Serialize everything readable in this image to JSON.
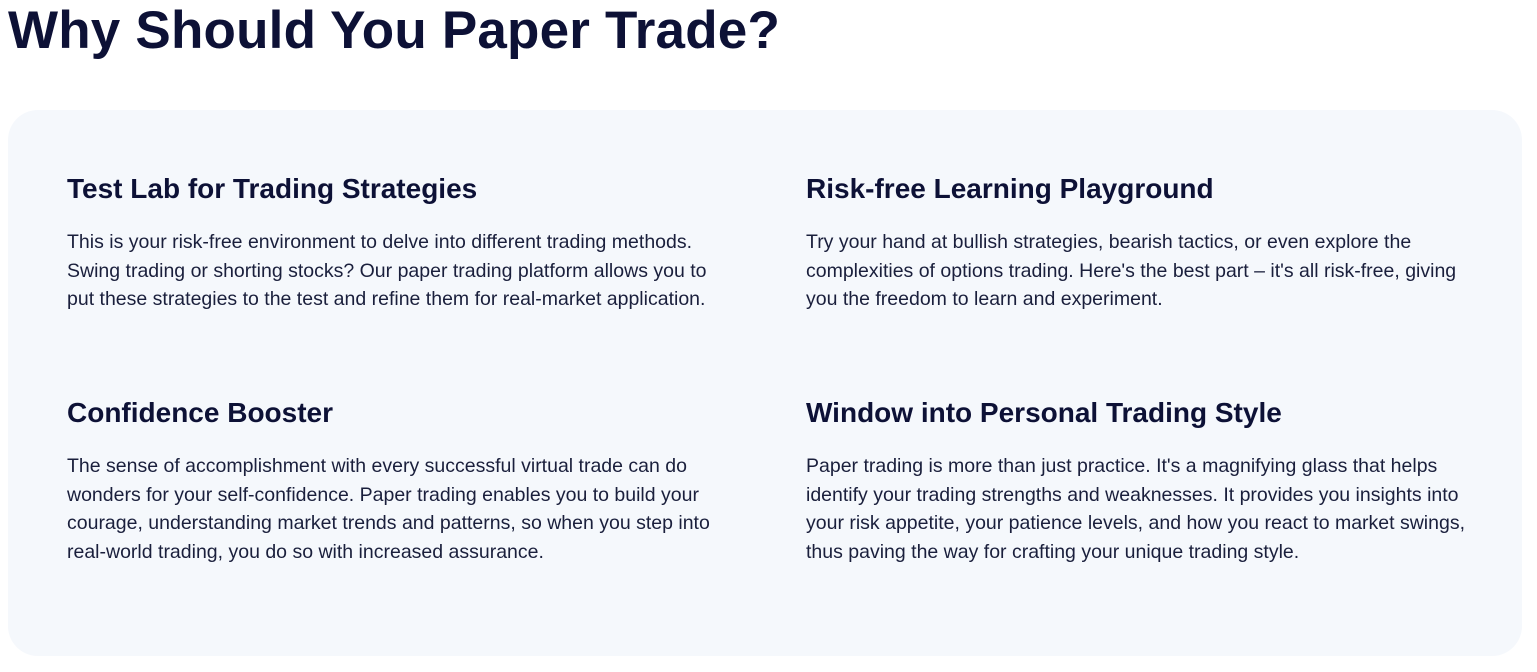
{
  "page": {
    "title": "Why Should You Paper Trade?"
  },
  "features": [
    {
      "heading": "Test Lab for Trading Strategies",
      "body": "This is your risk-free environment to delve into different trading methods. Swing trading or shorting stocks? Our paper trading platform allows you to put these strategies to the test and refine them for real-market application."
    },
    {
      "heading": "Risk-free Learning Playground",
      "body": "Try your hand at bullish strategies, bearish tactics, or even explore the complexities of options trading. Here's the best part – it's all risk-free, giving you the freedom to learn and experiment."
    },
    {
      "heading": "Confidence Booster",
      "body": "The sense of accomplishment with every successful virtual trade can do wonders for your self-confidence. Paper trading enables you to build your courage, understanding market trends and patterns, so when you step into real-world trading, you do so with increased assurance."
    },
    {
      "heading": "Window into Personal Trading Style",
      "body": "Paper trading is more than just practice. It's a magnifying glass that helps identify your trading strengths and weaknesses. It provides you insights into your risk appetite, your patience levels, and how you react to market swings, thus paving the way for crafting your unique trading style."
    }
  ],
  "colors": {
    "title": "#0d1136",
    "body_text": "#1a1f3c",
    "card_background": "#f5f8fc"
  }
}
